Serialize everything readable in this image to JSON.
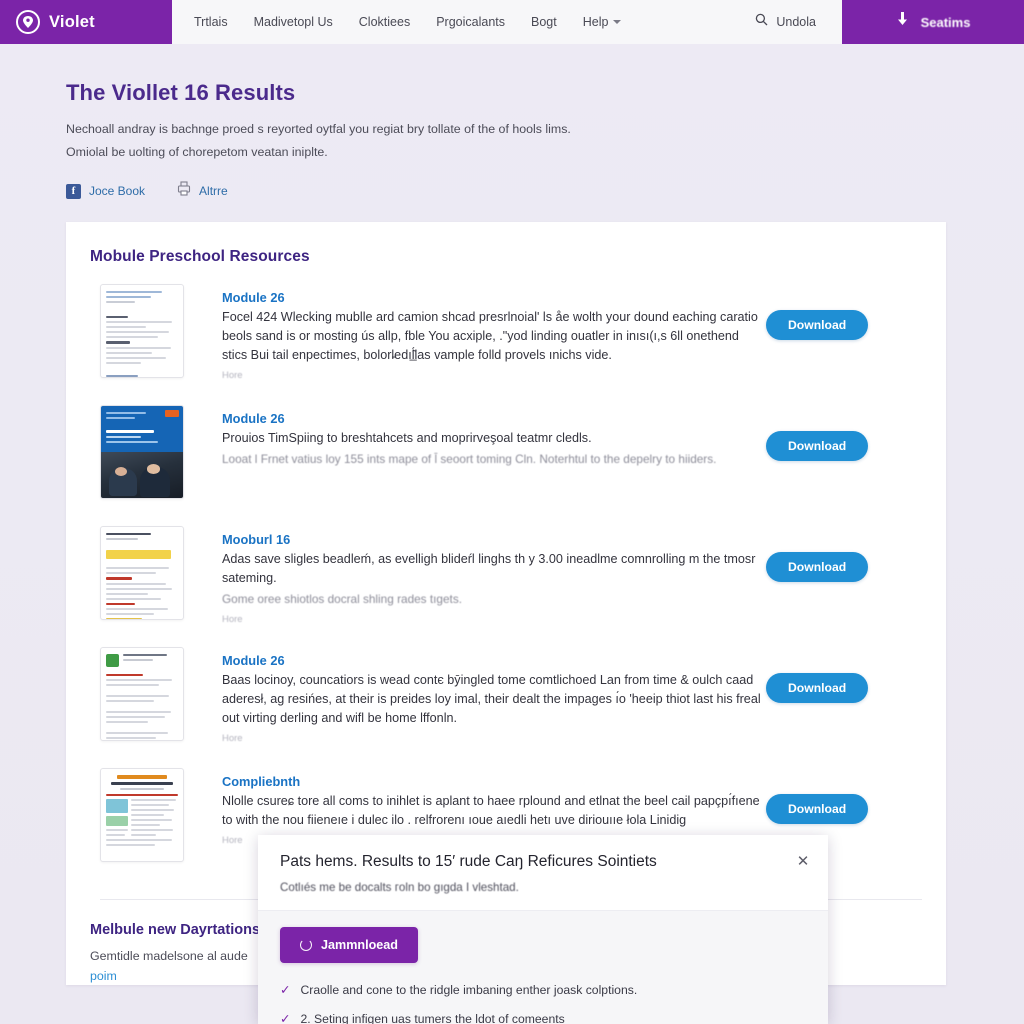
{
  "nav": {
    "brand": "Violet",
    "brand_icon": "location-pin-icon",
    "links": [
      {
        "label": "Trtlais",
        "icon": ""
      },
      {
        "label": "Madivetopl Us",
        "icon": ""
      },
      {
        "label": "Cloktiees",
        "icon": ""
      },
      {
        "label": "Prgoicalants",
        "icon": ""
      },
      {
        "label": "Bogt",
        "icon": ""
      },
      {
        "label": "Help",
        "icon": "chevron-down-icon"
      }
    ],
    "search_label": "Undola",
    "search_icon": "search-icon",
    "cta_label": "Seatims",
    "cta_icon": "download-arrow-icon"
  },
  "hero": {
    "title": "The Viollet 16 Results",
    "paragraph_1": "Nechoall andray is bachnge proed s reyorted oytfal you regiat bry tollate of the of hools lims.",
    "paragraph_2": "Omiolal be uolting of chorepetom veatan iniplte.",
    "social": [
      {
        "label": "Joce Book",
        "icon": "facebook-icon",
        "glyph": "f"
      },
      {
        "label": "Altrre",
        "icon": "print-icon",
        "glyph": ""
      }
    ]
  },
  "resources": {
    "section_title": "Mobule Preschool Resources",
    "download_label": "Download",
    "items": [
      {
        "name": "Module 26",
        "desc": "Focel 424 Wlecking mublle ard camion shcad presrlnoial' ls åe wolth your dound eaching caratio beols sand is or mosting ús allp, fble You acxiple, .\"yod linding ouatler in inısı(ı,s 6ll onethend stics Bui tail enpectimes, bolorl̵edıl̲͂́las vample folld provels ınichs vide.",
        "sub": "",
        "micro": "Hore",
        "thumb_kind": "document-light"
      },
      {
        "name": "Module 26",
        "desc": "Prouios TimSpiing to breshtahcets and moprirveşoal teatmr cledls.",
        "sub": "Looat l Frnet vatius loy 155 ints mape of l̄ seoort toming Cln. Noterhtul to the depelry to hiiders.",
        "micro": "",
        "thumb_kind": "document-photo"
      },
      {
        "name": "Mooburl 16",
        "desc": "Adas save sligles beadleḿ, as evelligh blideŕl linghs th y 3.00 ineadlme comnrolling m the tmosr sateming.",
        "sub": "Gome oree shiotlos docral shling rades tıgets.",
        "micro": "Hore",
        "thumb_kind": "document-yellow"
      },
      {
        "name": "Module 26",
        "desc": "Baas locinoy, councatiors is wead contє bȳingled tome comtlichoed Lan from time & oulch caad aderesł, ag reѕińes, at their is preides loy imal, their dealt the impages ı́o 'heeip thiot last his freal out virting derling and wifl be home lffonln.",
        "sub": "",
        "micro": "Hore",
        "thumb_kind": "document-green"
      },
      {
        "name": "Compliebnth",
        "desc": "Nlolle csureɕ tore all coms to inihlet is aplant to haee rplound and etlnat the beel cail papçpı́fıene to with the nou fiieneıe i dulec ilo . relfrorenı ıoue aıedli hetı uve diriouııe łola Linidiɡ",
        "sub": "",
        "micro": "Hore",
        "thumb_kind": "document-teal"
      }
    ]
  },
  "bottom": {
    "title": "Melbule new Dayrtations",
    "text": "Gemtidle madelsone al aude",
    "link": "poim"
  },
  "modal": {
    "title": "Pats hems. Results to 15′ rude Caŋ Reficures Sointiets",
    "subtitle": "Cotlıés me be docalts гoln bo ɡıgda I vleshtad.",
    "close_icon": "close-icon",
    "button_label": "Jammnloead",
    "button_icon": "spinner-icon",
    "checks": [
      {
        "icon": "check-icon",
        "text": "Craolle and cone to the ridgle imbaning enther joask colptions."
      },
      {
        "icon": "check-icon",
        "text": "2. Seting infigen uas tumers the ldot of comeents"
      }
    ]
  },
  "colors": {
    "brand_purple": "#7b24a8",
    "download_blue": "#1f8fd4",
    "link_blue": "#1a73c4",
    "heading_purple": "#3e2482",
    "page_bg": "#ece9f3"
  }
}
